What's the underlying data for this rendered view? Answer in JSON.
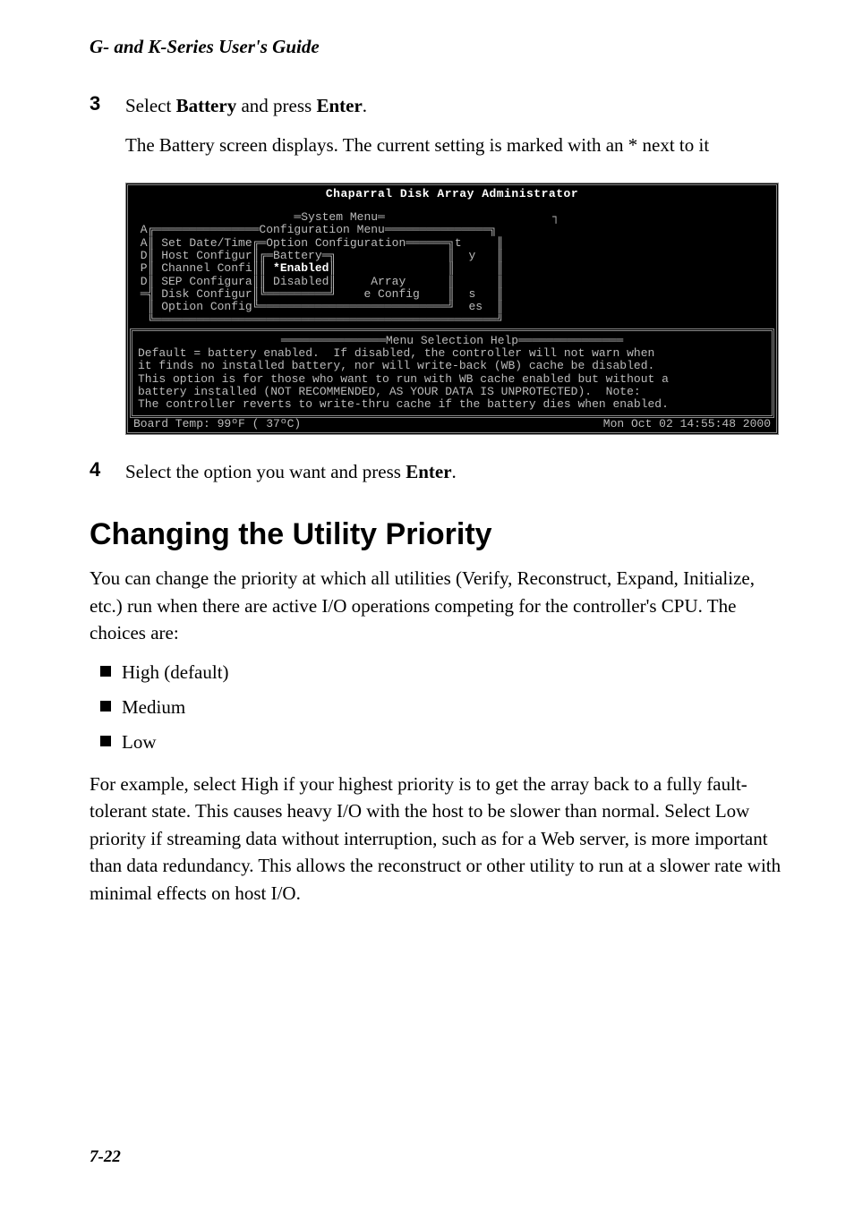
{
  "header": {
    "title": "G- and K-Series User's Guide"
  },
  "step3": {
    "num": "3",
    "line_pre": "Select ",
    "battery": "Battery",
    "line_mid": " and press ",
    "enter": "Enter",
    "line_post": ".",
    "desc": "The Battery screen displays. The current setting is marked with an * next to it"
  },
  "terminal": {
    "title": "Chaparral Disk Array Administrator",
    "lines": [
      "                       ═System Menu═                        ┐",
      " A╔═══════════════Configuration Menu═══════════════╗",
      " A║ Set Date/Time╔═Option Configuration══════╗t     ║",
      " D║ Host Configur║╔═Battery═╗                ║  y   ║",
      " P║ Channel Confi║║ *Enabled║                ║      ║",
      " D║ SEP Configura║║ Disabled║     Array      ║      ║",
      " ═╣ Disk Configur║╚═════════╝    e Config    ║  s   ║",
      "  ║ Option Config╚═══════════════════════════╝  es  ║",
      "  ╚═════════════════════════════════════════════════╝"
    ],
    "help_title": "═══════════════Menu Selection Help═══════════════",
    "help_lines": [
      "Default = battery enabled.  If disabled, the controller will not warn when",
      "it finds no installed battery, nor will write-back (WB) cache be disabled.",
      "This option is for those who want to run with WB cache enabled but without a",
      "battery installed (NOT RECOMMENDED, AS YOUR DATA IS UNPROTECTED).  Note:",
      "The controller reverts to write-thru cache if the battery dies when enabled."
    ],
    "status_left": "Board Temp:  99ºF ( 37ºC)",
    "status_right": "Mon Oct 02 14:55:48 2000"
  },
  "step4": {
    "num": "4",
    "line_pre": "Select the option you want and press ",
    "enter": "Enter",
    "line_post": "."
  },
  "section": {
    "heading": "Changing the Utility Priority",
    "intro": "You can change the priority at which all utilities (Verify, Reconstruct, Expand, Initialize, etc.) run when there are active I/O operations competing for the controller's CPU. The choices are:",
    "bullets": [
      "High (default)",
      "Medium",
      "Low"
    ],
    "closing": "For example, select High if your highest priority is to get the array back to a fully fault-tolerant state. This causes heavy I/O with the host to be slower than normal. Select Low priority if streaming data without interruption, such as for a Web server, is more important than data redundancy. This allows the reconstruct or other utility to run at a slower rate with minimal effects on host I/O."
  },
  "page_num": "7-22"
}
